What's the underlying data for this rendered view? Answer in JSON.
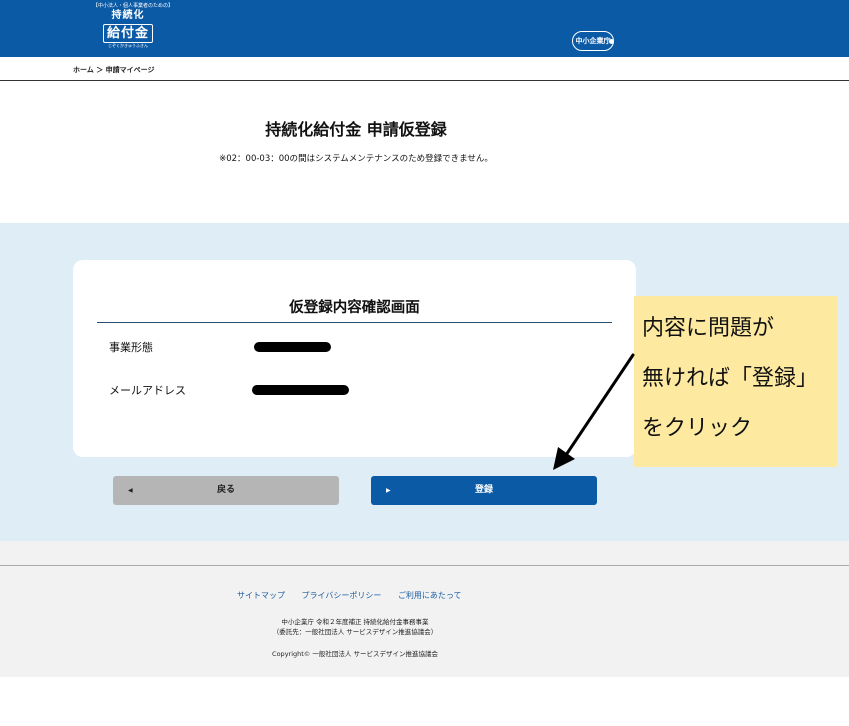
{
  "header": {
    "logo_tagline": "【中小法人・個人事業者のための】",
    "logo_sub": "持続化",
    "logo_main": "給付金",
    "logo_ruby": "じぞくかきゅうふきん",
    "agency": "中小企業庁"
  },
  "breadcrumb": "ホーム ＞ 申請マイページ",
  "page": {
    "title": "持続化給付金 申請仮登録",
    "notice": "※02：00-03：00の間はシステムメンテナンスのため登録できません。"
  },
  "card": {
    "title": "仮登録内容確認画面",
    "fields": [
      {
        "label": "事業形態"
      },
      {
        "label": "メールアドレス"
      }
    ]
  },
  "buttons": {
    "back_arrow": "◀",
    "back": "戻る",
    "register_arrow": "▶",
    "register": "登録"
  },
  "callout": {
    "lines": [
      "内容に問題が",
      "無ければ「登録」",
      "をクリック"
    ],
    "color": "#fde9a0"
  },
  "footer": {
    "links": [
      "サイトマップ",
      "プライバシーポリシー",
      "ご利用にあたって"
    ],
    "line1": "中小企業庁 令和２年度補正 持続化給付金事務事業",
    "line2": "（委託先：一般社団法人 サービスデザイン推進協議会）",
    "copyright": "Copyright© 一般社団法人 サービスデザイン推進協議会"
  },
  "colors": {
    "brand_blue": "#0a5aa6",
    "light_blue_bg": "#deedf6",
    "back_button": "#b5b5b5"
  }
}
